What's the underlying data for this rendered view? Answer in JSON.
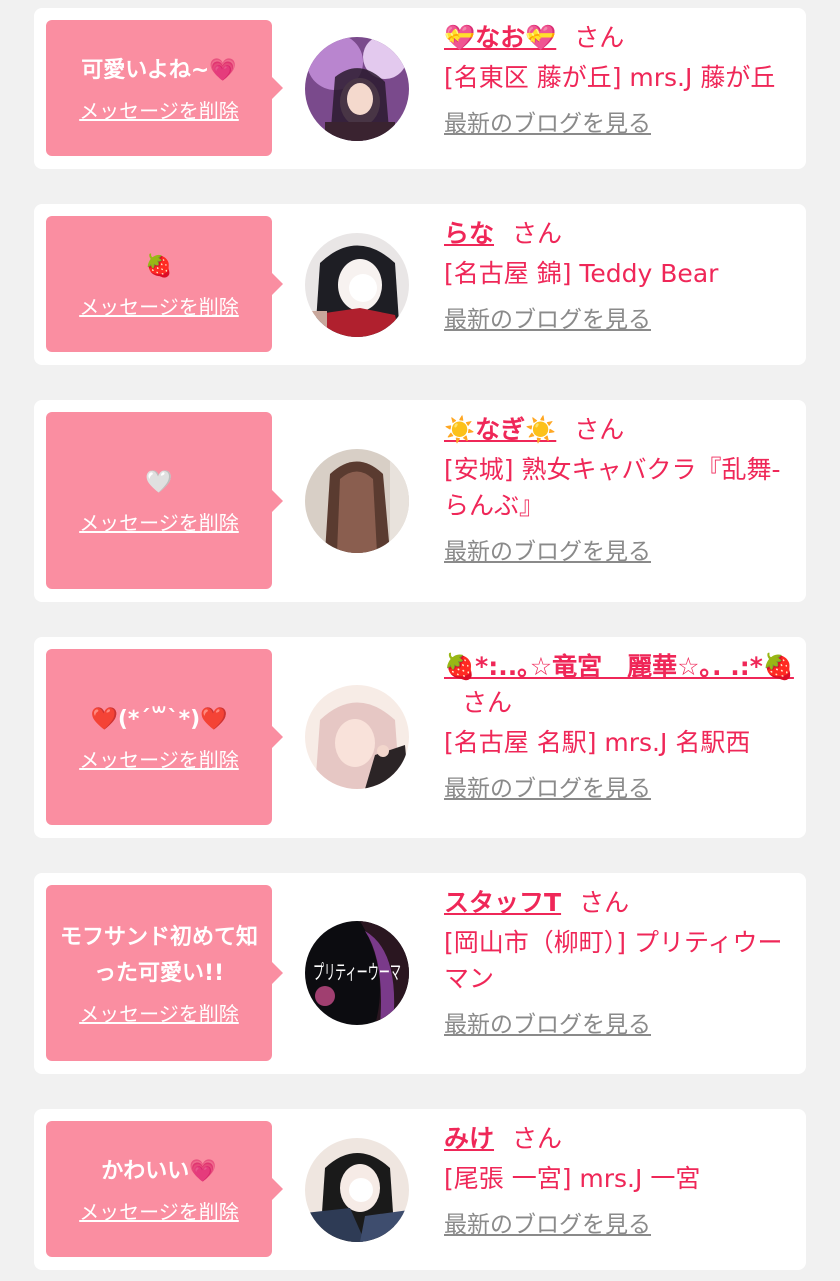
{
  "cards": [
    {
      "message": "可愛いよね~💗",
      "delete_label": "メッセージを削除",
      "name": "💝なお💝",
      "suffix": "さん",
      "shop": "[名東区 藤が丘] mrs.J 藤が丘",
      "blog_label": "最新のブログを見る",
      "avatar_icon": "profile-photo",
      "avatar_colors": [
        "#7a4a8c",
        "#d9b8e8",
        "#2a1a2e"
      ]
    },
    {
      "message": "🍓",
      "delete_label": "メッセージを削除",
      "name": "らな",
      "suffix": "さん",
      "shop": "[名古屋 錦] Teddy Bear",
      "blog_label": "最新のブログを見る",
      "avatar_icon": "profile-photo",
      "avatar_colors": [
        "#1e1e24",
        "#f4f4f4",
        "#b0202e"
      ]
    },
    {
      "message": "🤍",
      "delete_label": "メッセージを削除",
      "name": "☀️なぎ☀️",
      "suffix": "さん",
      "shop": "[安城] 熟女キャバクラ『乱舞-らんぶ』",
      "blog_label": "最新のブログを見る",
      "avatar_icon": "profile-photo",
      "avatar_colors": [
        "#5a3b30",
        "#d8cfc6",
        "#8a5e4f"
      ]
    },
    {
      "message": "❤️(*´꒳`*)❤️",
      "delete_label": "メッセージを削除",
      "name": "🍓*:..｡☆竜宮　麗華☆｡. .:*🍓",
      "suffix": "さん",
      "shop": "[名古屋 名駅] mrs.J 名駅西",
      "blog_label": "最新のブログを見る",
      "avatar_icon": "profile-photo",
      "avatar_colors": [
        "#e6c7c4",
        "#f7ece6",
        "#2b2426"
      ]
    },
    {
      "message": "モフサンド初めて知った可愛い!!",
      "delete_label": "メッセージを削除",
      "name": "スタッフT",
      "suffix": "さん",
      "shop": "[岡山市（柳町）] プリティウーマン",
      "blog_label": "最新のブログを見る",
      "avatar_icon": "club-logo",
      "avatar_text": "プリティーウーマ",
      "avatar_colors": [
        "#0c0c10",
        "#7a3a8a",
        "#e0569a"
      ]
    },
    {
      "message": "かわいい💗",
      "delete_label": "メッセージを削除",
      "name": "みけ",
      "suffix": "さん",
      "shop": "[尾張 一宮] mrs.J 一宮",
      "blog_label": "最新のブログを見る",
      "avatar_icon": "profile-photo",
      "avatar_colors": [
        "#2e3b55",
        "#efe6e0",
        "#1a1a1a"
      ]
    }
  ]
}
